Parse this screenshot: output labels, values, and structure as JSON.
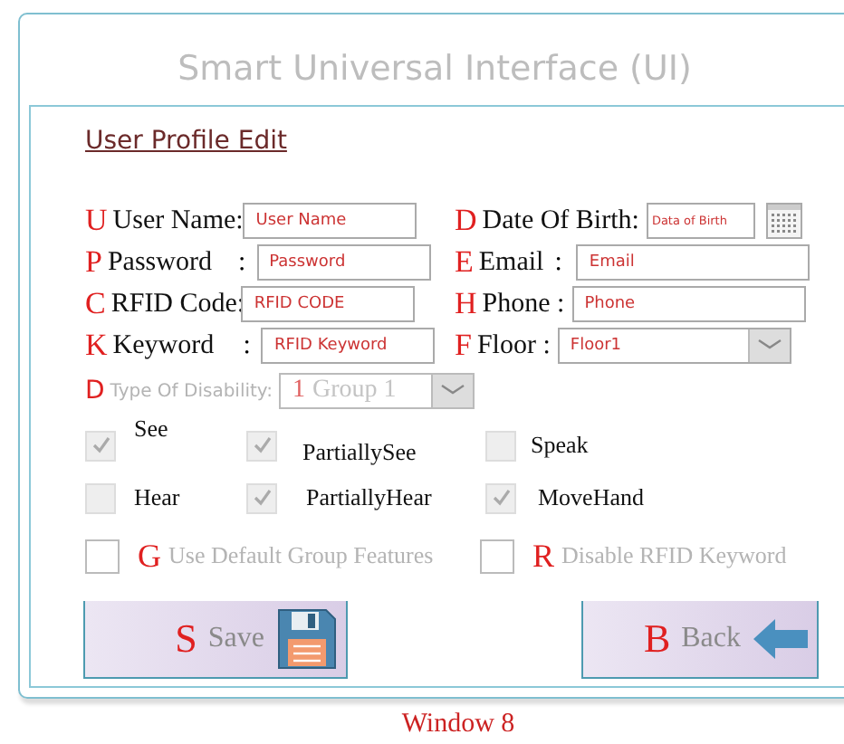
{
  "window": {
    "title": "Smart Universal Interface (UI)"
  },
  "form": {
    "heading": "User Profile Edit",
    "rows": [
      {
        "left": {
          "key": "U",
          "label": "User Name:",
          "kind": "text",
          "placeholder": "User Name"
        },
        "right": {
          "key": "D",
          "label": "Date Of Birth:",
          "kind": "date",
          "placeholder": "Data of Birth"
        }
      },
      {
        "left": {
          "key": "P",
          "label": "Password",
          "colon": ":",
          "kind": "text",
          "placeholder": "Password"
        },
        "right": {
          "key": "E",
          "label": "Email",
          "colon": ":",
          "kind": "text",
          "placeholder": "Email"
        }
      },
      {
        "left": {
          "key": "C",
          "label": "RFID Code:",
          "kind": "text",
          "placeholder": "RFID CODE"
        },
        "right": {
          "key": "H",
          "label": "Phone :",
          "kind": "text",
          "placeholder": "Phone"
        }
      },
      {
        "left": {
          "key": "K",
          "label": "Keyword",
          "colon": ":",
          "kind": "text",
          "placeholder": "RFID Keyword"
        },
        "right": {
          "key": "F",
          "label": "Floor :",
          "kind": "dropdown",
          "value": "Floor1"
        }
      }
    ],
    "disability": {
      "key": "D",
      "label": "Type Of Disability:",
      "number": "1",
      "value": "Group 1",
      "disabled": true
    },
    "abilities": [
      {
        "label": "See",
        "checked": true
      },
      {
        "label": "PartiallySee",
        "checked": true
      },
      {
        "label": "Speak",
        "checked": false
      },
      {
        "label": "Hear",
        "checked": false
      },
      {
        "label": "PartiallyHear",
        "checked": true
      },
      {
        "label": "MoveHand",
        "checked": true
      }
    ],
    "options": [
      {
        "key": "G",
        "label": "Use Default Group Features",
        "checked": false,
        "disabled": true
      },
      {
        "key": "R",
        "label": "Disable RFID Keyword",
        "checked": false,
        "disabled": true
      }
    ]
  },
  "buttons": [
    {
      "key": "S",
      "label": "Save",
      "kind": "save",
      "disabled": true
    },
    {
      "key": "B",
      "label": "Back",
      "kind": "back",
      "disabled": true
    }
  ],
  "caption": "Window 8"
}
